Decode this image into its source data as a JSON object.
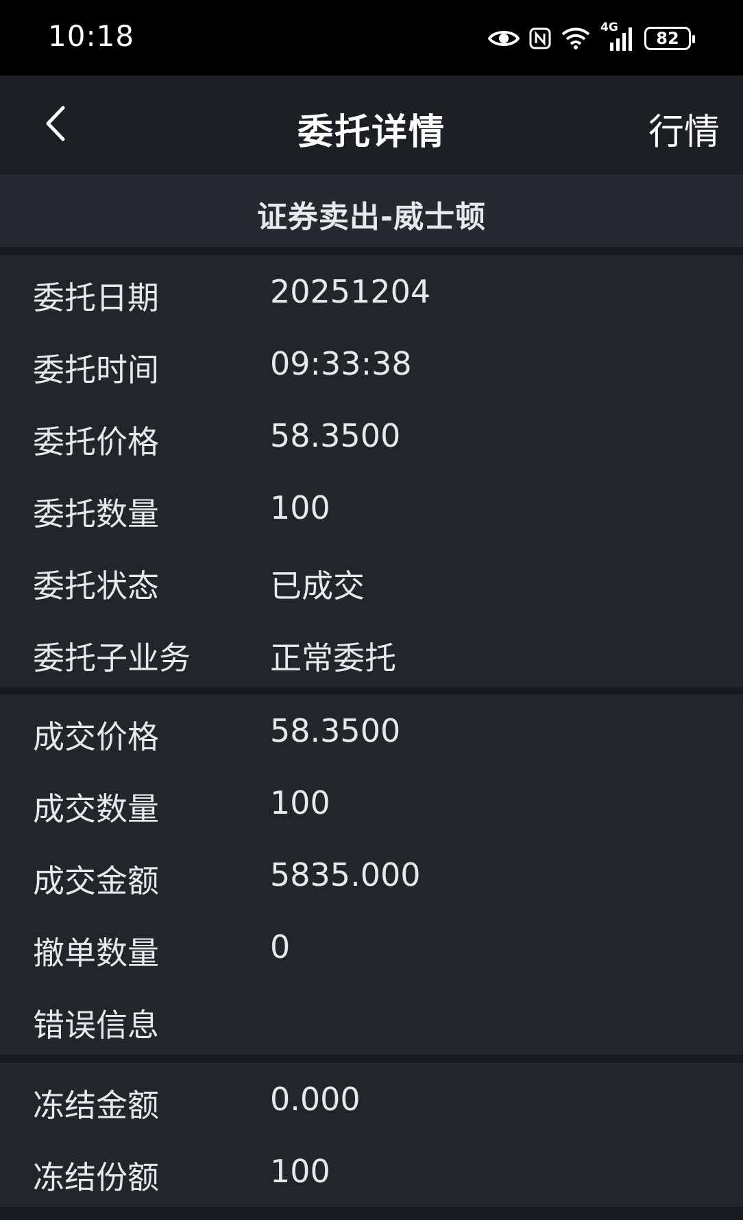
{
  "status_bar": {
    "time": "10:18",
    "network": "4G",
    "battery": "82",
    "icons": [
      "eye-icon",
      "nfc-icon",
      "wifi-icon",
      "signal-icon",
      "battery-icon"
    ]
  },
  "header": {
    "back_icon": "chevron-left-icon",
    "title": "委托详情",
    "right_action": "行情"
  },
  "sub_header": {
    "title": "证券卖出-威士顿"
  },
  "sections": {
    "order": [
      {
        "label": "委托日期",
        "value": "20251204"
      },
      {
        "label": "委托时间",
        "value": "09:33:38"
      },
      {
        "label": "委托价格",
        "value": "58.3500"
      },
      {
        "label": "委托数量",
        "value": "100"
      },
      {
        "label": "委托状态",
        "value": "已成交"
      },
      {
        "label": "委托子业务",
        "value": "正常委托"
      }
    ],
    "trade": [
      {
        "label": "成交价格",
        "value": "58.3500"
      },
      {
        "label": "成交数量",
        "value": "100"
      },
      {
        "label": "成交金额",
        "value": "5835.000"
      },
      {
        "label": "撤单数量",
        "value": "0"
      },
      {
        "label": "错误信息",
        "value": ""
      }
    ],
    "frozen": [
      {
        "label": "冻结金额",
        "value": "0.000"
      },
      {
        "label": "冻结份额",
        "value": "100"
      }
    ]
  },
  "colors": {
    "status_bar_bg": "#000000",
    "nav_bg": "#1c1f23",
    "sub_header_bg": "#242a30",
    "section_bg": "#22262a",
    "separator": "#171a1e",
    "text": "#e6e8eb"
  }
}
